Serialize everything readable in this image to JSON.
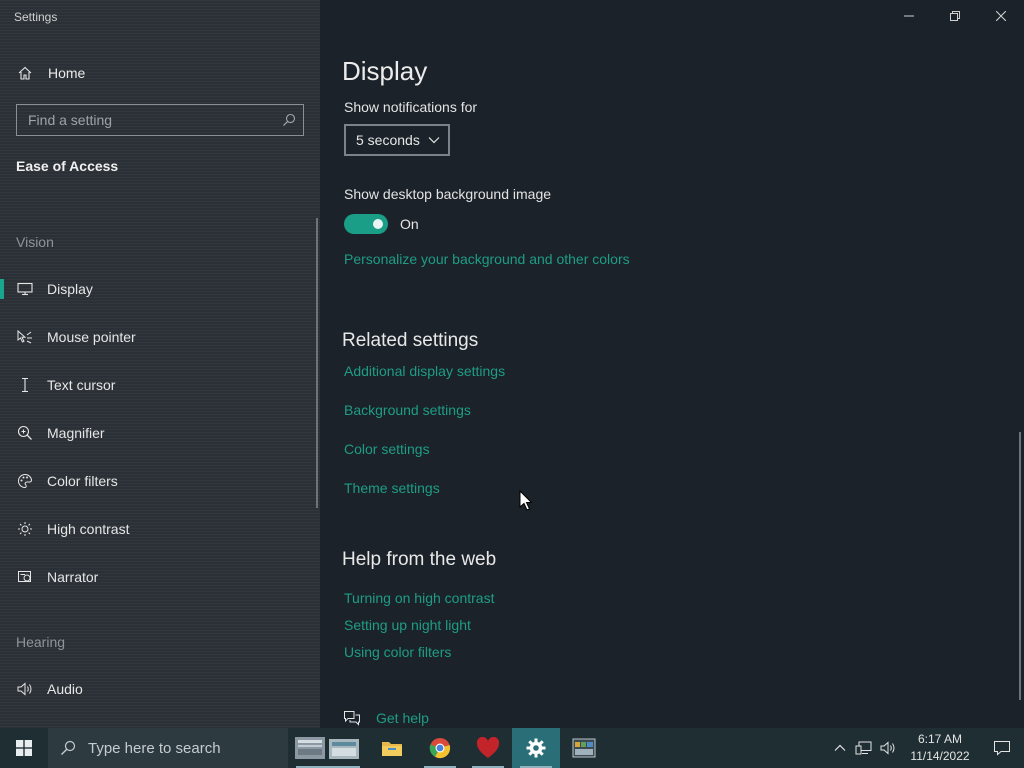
{
  "window": {
    "title": "Settings"
  },
  "sidebar": {
    "home_label": "Home",
    "search_placeholder": "Find a setting",
    "section_title": "Ease of Access",
    "vision_label": "Vision",
    "hearing_label": "Hearing",
    "items": [
      {
        "label": "Display",
        "icon": "monitor-icon",
        "active": true
      },
      {
        "label": "Mouse pointer",
        "icon": "mouse-pointer-icon"
      },
      {
        "label": "Text cursor",
        "icon": "text-cursor-icon"
      },
      {
        "label": "Magnifier",
        "icon": "magnifier-icon"
      },
      {
        "label": "Color filters",
        "icon": "palette-icon"
      },
      {
        "label": "High contrast",
        "icon": "sun-icon"
      },
      {
        "label": "Narrator",
        "icon": "narrator-icon"
      }
    ],
    "hearing_items": [
      {
        "label": "Audio",
        "icon": "speaker-icon"
      }
    ]
  },
  "main": {
    "page_title": "Display",
    "notifications_label": "Show notifications for",
    "notifications_value": "5 seconds",
    "background_label": "Show desktop background image",
    "background_toggle": {
      "state": "On",
      "on": true
    },
    "personalize_link": "Personalize your background and other colors",
    "related": {
      "heading": "Related settings",
      "links": [
        "Additional display settings",
        "Background settings",
        "Color settings",
        "Theme settings"
      ]
    },
    "help": {
      "heading": "Help from the web",
      "links": [
        "Turning on high contrast",
        "Setting up night light",
        "Using color filters"
      ]
    },
    "get_help": "Get help"
  },
  "taskbar": {
    "search_placeholder": "Type here to search",
    "apps": [
      "task-view-icon",
      "file-explorer-icon",
      "chrome-icon",
      "heart-app-icon",
      "settings-icon",
      "media-app-icon"
    ],
    "clock_time": "6:17 AM",
    "clock_date": "11/14/2022"
  },
  "colors": {
    "accent": "#1aa58e",
    "link": "#1e9d85",
    "background": "#1b2229",
    "sidebar": "#2a3036"
  }
}
